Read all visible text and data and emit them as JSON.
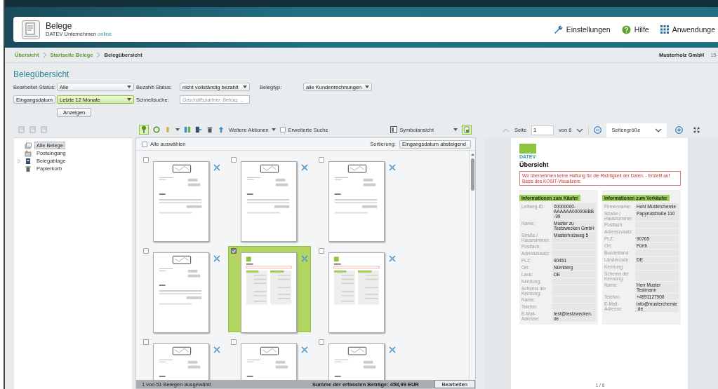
{
  "header": {
    "app_title": "Belege",
    "app_subtitle": "DATEV Unternehmen",
    "app_subtitle_highlight": "online",
    "links": [
      {
        "kind": "settings",
        "label": "Einstellungen"
      },
      {
        "kind": "help",
        "label": "Hilfe"
      },
      {
        "kind": "apps",
        "label": "Anwendunge"
      }
    ]
  },
  "breadcrumb": [
    {
      "label": "Übersicht",
      "current": false
    },
    {
      "label": "Startseite Belege",
      "current": false
    },
    {
      "label": "Belegübersicht",
      "current": true
    }
  ],
  "company": "Musterholz GmbH",
  "company_suffix": "15-",
  "page_title": "Belegübersicht",
  "filters": {
    "bearbeitet": {
      "label": "Bearbeitet-Status:",
      "value": "Alle",
      "highlighted": false
    },
    "bezahlt": {
      "label": "Bezahlt-Status:",
      "value": "nicht vollständig bezahlt",
      "highlighted": false
    },
    "belegtyp": {
      "label": "Belegtyp:",
      "value": "alle Kundenrechnungen",
      "highlighted": false
    },
    "date_field": {
      "value": "Eingangsdatum",
      "highlighted": false
    },
    "date_range": {
      "value": "Letzte 12 Monate",
      "highlighted": true
    },
    "schnellsuche": {
      "label": "Schnellsuche:",
      "placeholder": "Geschäftspartner, Betrag, ..."
    },
    "button": "Anzeigen"
  },
  "tree": [
    {
      "label": "Alle Belege",
      "selected": true
    },
    {
      "label": "Posteingang",
      "selected": false
    },
    {
      "label": "Belegablage",
      "selected": false,
      "expanded": false
    },
    {
      "label": "Papierkorb",
      "selected": false
    }
  ],
  "toolbar": {
    "more_actions": "Weitere Aktionen",
    "extended_search": {
      "label": "Erweiterte Suche",
      "checked": false
    },
    "view": "Symbolansicht"
  },
  "select_all": {
    "label": "Alle auswählen",
    "checked": false
  },
  "sort": {
    "label": "Sortierung:",
    "value": "Eingangsdatum absteigend"
  },
  "documents": [
    {
      "kind": "invoice",
      "selected": false
    },
    {
      "kind": "invoice",
      "selected": false
    },
    {
      "kind": "invoice",
      "selected": false
    },
    {
      "kind": "invoice",
      "selected": false
    },
    {
      "kind": "overview",
      "selected": true
    },
    {
      "kind": "overview",
      "selected": false
    },
    {
      "kind": "invoice",
      "selected": false
    },
    {
      "kind": "invoice",
      "selected": false
    },
    {
      "kind": "invoice",
      "selected": false
    }
  ],
  "status_bar": {
    "selection": "1 von 51 Belegen ausgewählt",
    "total": "Summe der erfassten Beträge: 458,99 EUR",
    "button": "Bearbeiten"
  },
  "preview": {
    "page_label": "Seite",
    "page": "1",
    "page_of": "von 6",
    "zoom": "Seitengröße",
    "document": {
      "logo": "DATEV",
      "title": "Übersicht",
      "notice": "Wir übernehmen keine Haftung für die Richtigkeit der Daten. - Erstellt auf Basis des KOSIT-Visualizers.",
      "sections": [
        {
          "title": "Informationen zum Käufer",
          "fields": [
            {
              "label": "Leitweg-ID:",
              "value": "00000000-AAAAAA00000BBB-99"
            },
            {
              "label": "Name:",
              "value": "Muster zu Testzwecken GmbH"
            },
            {
              "label": "Straße / Hausnummer:",
              "value": "Musterholzweg 5"
            },
            {
              "label": "Postfach:"
            },
            {
              "label": "Adresszusatz:"
            },
            {
              "label": "PLZ:",
              "value": "90451"
            },
            {
              "label": "Ort:",
              "value": "Nürnberg"
            },
            {
              "label": "Land:",
              "value": "DE"
            },
            {
              "label": "Kennung:"
            },
            {
              "label": "Schema der Kennung:"
            },
            {
              "label": "Name:"
            },
            {
              "label": "Telefon:"
            },
            {
              "label": "E-Mail-Adresse:",
              "value": "test@testzwecken.de"
            }
          ]
        },
        {
          "title": "Informationen zum Verkäufer",
          "fields": [
            {
              "label": "Firmenname:",
              "value": "Hohl Musterchemie"
            },
            {
              "label": "Straße / Hausnummer:",
              "value": "Papyrusstraße 110"
            },
            {
              "label": "Postfach:"
            },
            {
              "label": "Adresszusatz:"
            },
            {
              "label": "PLZ:",
              "value": "90765"
            },
            {
              "label": "Ort:",
              "value": "Fürth"
            },
            {
              "label": "Bundesland:"
            },
            {
              "label": "Ländercode:",
              "value": "DE"
            },
            {
              "label": "Kennung:"
            },
            {
              "label": "Schema der Kennung:"
            },
            {
              "label": "Name:",
              "value": "Herr Muster Testmann"
            },
            {
              "label": "Telefon:",
              "value": "+4991127900"
            },
            {
              "label": "E-Mail-Adresse:",
              "value": "info@musterchemie.de"
            }
          ]
        }
      ]
    },
    "page_footer": "1 / 6"
  }
}
